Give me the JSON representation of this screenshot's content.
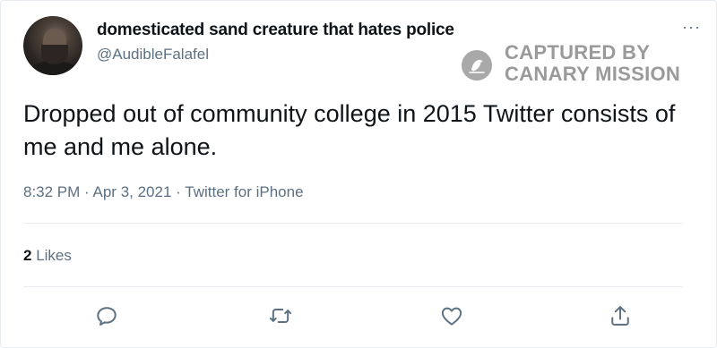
{
  "tweet": {
    "display_name": "domesticated sand creature that hates police",
    "handle": "@AudibleFalafel",
    "text": "Dropped out of community college in 2015 Twitter consists of me and me alone.",
    "time": "8:32 PM",
    "separator": "·",
    "date": "Apr 3, 2021",
    "source": "Twitter for iPhone",
    "likes_count": "2",
    "likes_label": "Likes",
    "more_label": "···"
  },
  "watermark": {
    "text": "CAPTURED BY\nCANARY MISSION"
  },
  "icons": {
    "reply": "reply-icon",
    "retweet": "retweet-icon",
    "like": "heart-icon",
    "share": "share-icon",
    "more": "more-icon"
  },
  "colors": {
    "text": "#0f1419",
    "secondary": "#5b7083",
    "divider": "#e6ecf0",
    "watermark": "#9a9a9a"
  }
}
